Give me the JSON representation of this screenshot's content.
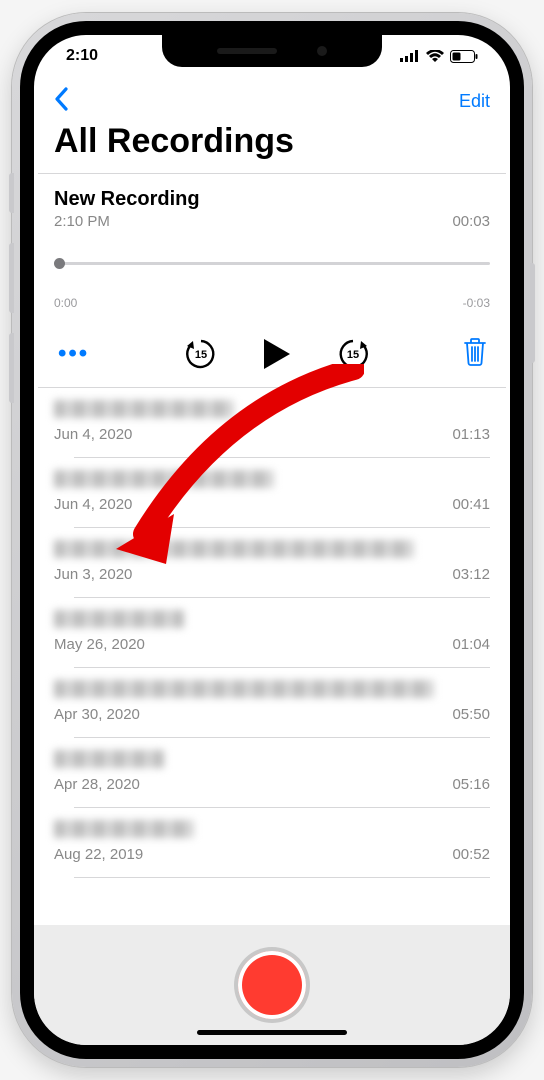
{
  "status": {
    "time": "2:10"
  },
  "nav": {
    "edit": "Edit"
  },
  "title": "All Recordings",
  "selected": {
    "name": "New Recording",
    "time": "2:10 PM",
    "duration": "00:03",
    "playhead_left": "0:00",
    "playhead_right": "-0:03"
  },
  "recordings": [
    {
      "date": "Jun 4, 2020",
      "duration": "01:13",
      "blur_w": 180
    },
    {
      "date": "Jun 4, 2020",
      "duration": "00:41",
      "blur_w": 220
    },
    {
      "date": "Jun 3, 2020",
      "duration": "03:12",
      "blur_w": 360
    },
    {
      "date": "May 26, 2020",
      "duration": "01:04",
      "blur_w": 130
    },
    {
      "date": "Apr 30, 2020",
      "duration": "05:50",
      "blur_w": 380
    },
    {
      "date": "Apr 28, 2020",
      "duration": "05:16",
      "blur_w": 110
    },
    {
      "date": "Aug 22, 2019",
      "duration": "00:52",
      "blur_w": 140
    }
  ],
  "icons": {
    "back": "chevron-left-icon",
    "more": "•••",
    "skip_back": "15",
    "skip_fwd": "15"
  },
  "colors": {
    "accent": "#007aff",
    "record": "#ff3b30"
  }
}
